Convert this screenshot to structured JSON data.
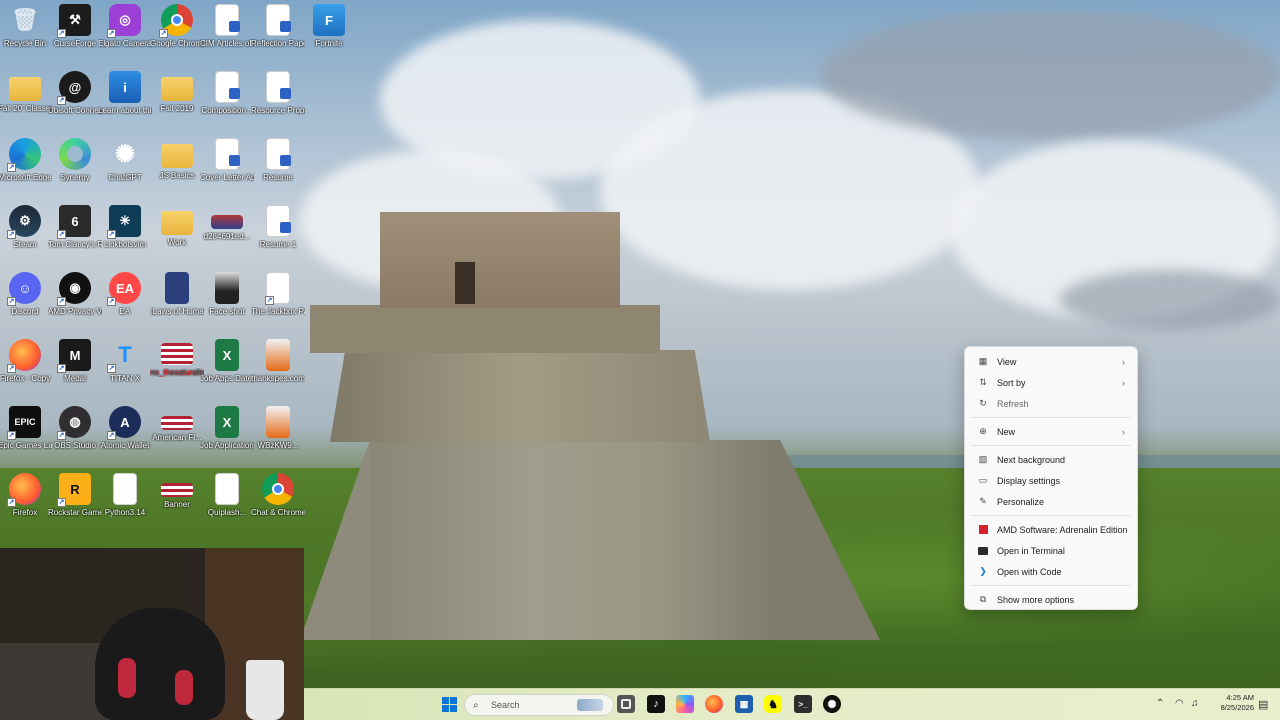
{
  "desktop": {
    "icons": [
      {
        "label": "Recycle Bin"
      },
      {
        "label": "CurseForge"
      },
      {
        "label": "Elgato Camera Hub"
      },
      {
        "label": "Google Chrome"
      },
      {
        "label": "CIM Articles of organiza..."
      },
      {
        "label": "Reflection Paper.do..."
      },
      {
        "label": "Fortnite"
      },
      {
        "label": "Fall 20' Classes"
      },
      {
        "label": "Ubisoft Connect"
      },
      {
        "label": "Learn about this picture"
      },
      {
        "label": "Fall 2019"
      },
      {
        "label": "Composition..."
      },
      {
        "label": "Resource Proposal"
      },
      {
        "label": "Microsoft Edge"
      },
      {
        "label": "Synergy"
      },
      {
        "label": "ChatGPT"
      },
      {
        "label": "JS Basics"
      },
      {
        "label": "Cover Letter Administrat..."
      },
      {
        "label": "Resume"
      },
      {
        "label": "Steam"
      },
      {
        "label": "Tom Clancy's Rainbow Six..."
      },
      {
        "label": "Linkbotsvim"
      },
      {
        "label": "Work"
      },
      {
        "label": "d284691ed..."
      },
      {
        "label": "Resume 1"
      },
      {
        "label": "Discord"
      },
      {
        "label": "AMD Privacy View"
      },
      {
        "label": "EA"
      },
      {
        "label": "(Laws of Human Na..."
      },
      {
        "label": "Face shot"
      },
      {
        "label": "The Jackbox Party Pack"
      },
      {
        "label": "Firefox - Copy"
      },
      {
        "label": "Medal"
      },
      {
        "label": "TITAN X"
      },
      {
        "label": "no_thesaturalingvis"
      },
      {
        "label": "Job Apps Dates"
      },
      {
        "label": "thankspes.com"
      },
      {
        "label": "Epic Games Launcher"
      },
      {
        "label": "OBS Studio"
      },
      {
        "label": "Atomic Wallet"
      },
      {
        "label": "American Fl..."
      },
      {
        "label": "Job Applications"
      },
      {
        "label": "WBzKW9..."
      },
      {
        "label": "Firefox"
      },
      {
        "label": "Rockstar Games..."
      },
      {
        "label": "Python3.14"
      },
      {
        "label": "Banner"
      },
      {
        "label": "Quiplash..."
      },
      {
        "label": "Chat & Chrome"
      }
    ]
  },
  "context_menu": {
    "items": [
      {
        "label": "View",
        "icon": "grid-icon",
        "submenu": true
      },
      {
        "label": "Sort by",
        "icon": "sort-icon",
        "submenu": true
      },
      {
        "label": "Refresh",
        "icon": "refresh-icon"
      },
      {
        "label": "New",
        "icon": "plus-icon",
        "submenu": true
      },
      {
        "label": "Next background",
        "icon": "next-background-icon"
      },
      {
        "label": "Display settings",
        "icon": "display-icon"
      },
      {
        "label": "Personalize",
        "icon": "pen-icon"
      },
      {
        "label": "AMD Software: Adrenalin Edition",
        "icon": "amd-icon"
      },
      {
        "label": "Open in Terminal",
        "icon": "terminal-icon"
      },
      {
        "label": "Open with Code",
        "icon": "vscode-icon"
      },
      {
        "label": "Show more options",
        "icon": "more-options-icon"
      }
    ]
  },
  "taskbar": {
    "search_placeholder": "Search",
    "clock_time": "4:25 AM",
    "clock_date": "8/25/2026",
    "apps": [
      "start",
      "file-explorer",
      "tiktok",
      "copilot",
      "firefox",
      "microsoft-store",
      "snapchat",
      "terminal",
      "chatgpt"
    ]
  },
  "colors": {
    "taskbar": "#e4ecc7",
    "menu_bg": "#f9f9f9",
    "accent": "#0067c0"
  }
}
